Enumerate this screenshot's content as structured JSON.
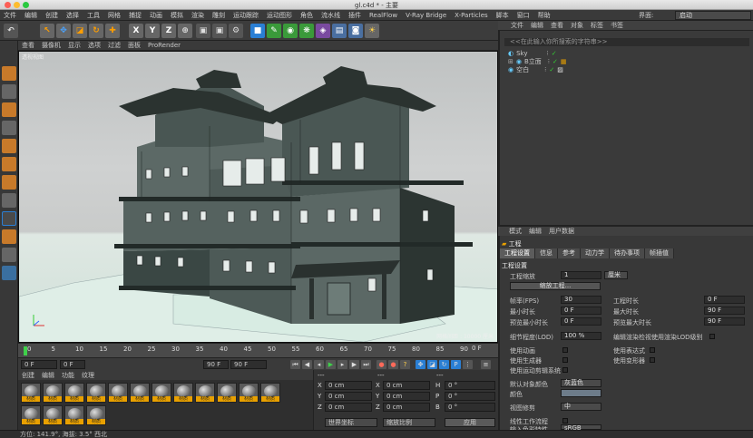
{
  "window": {
    "title": "gl.c4d * - 主要"
  },
  "menubar": {
    "items": [
      "文件",
      "编辑",
      "创建",
      "选择",
      "工具",
      "网格",
      "捕捉",
      "动画",
      "模拟",
      "渲染",
      "雕刻",
      "运动跟踪",
      "运动图形",
      "角色",
      "流水线",
      "插件",
      "RealFlow",
      "V-Ray Bridge",
      "X-Particles",
      "脚本",
      "窗口",
      "帮助"
    ],
    "layout_label": "界面:",
    "layout_value": "启动"
  },
  "toolbar": {
    "axis_x": "X",
    "axis_y": "Y",
    "axis_z": "Z"
  },
  "viewport": {
    "menu": [
      "查看",
      "摄像机",
      "显示",
      "选项",
      "过滤",
      "面板",
      "ProRender"
    ],
    "camera_label": "透视视图",
    "grid_info": "网格间距 : 10000 厘米"
  },
  "timeline": {
    "ticks": [
      "0",
      "5",
      "10",
      "15",
      "20",
      "25",
      "30",
      "35",
      "40",
      "45",
      "50",
      "55",
      "60",
      "65",
      "70",
      "75",
      "80",
      "85",
      "90"
    ],
    "end_frame": "0 F"
  },
  "transport": {
    "start": "0 F",
    "cur": "0 F",
    "end": "90 F",
    "max": "90 F"
  },
  "materials": {
    "menu": [
      "创建",
      "编辑",
      "功能",
      "纹理"
    ],
    "label": "材质",
    "count": 16
  },
  "coords": {
    "header": "---",
    "rows": [
      {
        "axis": "X",
        "pos": "0 cm",
        "rot_axis": "X",
        "rot": "0 cm",
        "ang_axis": "H",
        "ang": "0 °"
      },
      {
        "axis": "Y",
        "pos": "0 cm",
        "rot_axis": "Y",
        "rot": "0 cm",
        "ang_axis": "P",
        "ang": "0 °"
      },
      {
        "axis": "Z",
        "pos": "0 cm",
        "rot_axis": "Z",
        "rot": "0 cm",
        "ang_axis": "B",
        "ang": "0 °"
      }
    ],
    "mode1": "世界坐标",
    "mode2": "缩放比例",
    "apply": "应用"
  },
  "objmgr": {
    "menu": [
      "文件",
      "编辑",
      "查看",
      "对象",
      "标签",
      "书签"
    ],
    "search": "<<在此输入你所搜索的字符串>>",
    "objects": [
      "Sky",
      "B立面",
      "空白"
    ]
  },
  "attrs": {
    "menu": [
      "模式",
      "编辑",
      "用户数据"
    ],
    "section": "工程",
    "tabs": [
      "工程设置",
      "信息",
      "参考",
      "动力学",
      "待办事项",
      "帧插值"
    ],
    "group": "工程设置",
    "scale_label": "工程缩放",
    "scale_value": "1",
    "scale_unit": "厘米",
    "scale_btn": "缩放工程...",
    "fps_label": "帧率(FPS)",
    "fps": "30",
    "time_label": "工程时长",
    "time": "0 F",
    "min_label": "最小时长",
    "min": "0 F",
    "max_label": "最大时长",
    "max": "90 F",
    "pmin_label": "预览最小时长",
    "pmin": "0 F",
    "pmax_label": "预览最大时长",
    "pmax": "90 F",
    "lod_label": "细节程度(LOD)",
    "lod": "100 %",
    "lod_check": "编辑渲染检视使用渲染LOD级别",
    "anim": "使用动画",
    "expr": "使用表达式",
    "gen": "使用生成器",
    "deform": "使用变形器",
    "motion": "使用运动剪辑系统",
    "defcolor_label": "默认对象颜色",
    "defcolor": "灰蓝色",
    "color_label": "颜色",
    "clip_label": "视图修剪",
    "clip": "中",
    "linear": "线性工作流程",
    "input_label": "输入色彩特性",
    "input": "sRGB"
  },
  "status": {
    "text": "方位: 141.9°, 海拔: 3.5° 西北"
  }
}
